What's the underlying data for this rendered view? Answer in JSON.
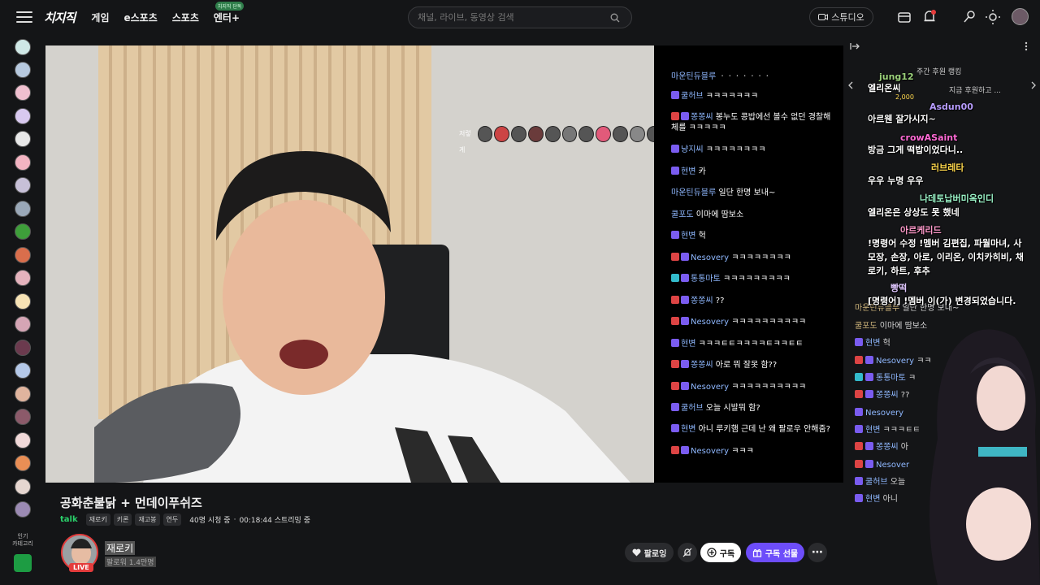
{
  "nav": {
    "logo": "치지직",
    "items": [
      "게임",
      "e스포츠",
      "스포츠",
      "엔터+"
    ],
    "enter_badge": "치지직 단독",
    "search_placeholder": "채널, 라이브, 동영상 검색",
    "studio_label": "스튜디오"
  },
  "sidebar": {
    "popular_label_1": "인기",
    "popular_label_2": "카테고리"
  },
  "video": {
    "emote_prefix": "저렇게"
  },
  "video_chat": [
    {
      "nick": "마운틴듀블루",
      "text": "ㆍㆍㆍㆍㆍㆍㆍ"
    },
    {
      "nick": "쿨허브",
      "text": "ㅋㅋㅋㅋㅋㅋㅋ"
    },
    {
      "nick": "쫑쫑씨",
      "text": "봉누도 콩밥에선 볼수 없던 경찰해체를 ㅋㅋㅋㅋㅋ"
    },
    {
      "nick": "냥지씨",
      "text": "ㅋㅋㅋㅋㅋㅋㅋㅋ"
    },
    {
      "nick": "현변",
      "text": "카"
    },
    {
      "nick": "마운틴듀블루",
      "text": "일단 한명 보내~"
    },
    {
      "nick": "쿨포도",
      "text": "이마에 땀보소"
    },
    {
      "nick": "현변",
      "text": "헉"
    },
    {
      "nick": "Nesovery",
      "text": "ㅋㅋㅋㅋㅋㅋㅋㅋ"
    },
    {
      "nick": "통통마토",
      "text": "ㅋㅋㅋㅋㅋㅋㅋㅋㅋ"
    },
    {
      "nick": "쫑쫑씨",
      "text": "??"
    },
    {
      "nick": "Nesovery",
      "text": "ㅋㅋㅋㅋㅋㅋㅋㅋㅋㅋ"
    },
    {
      "nick": "현변",
      "text": "ㅋㅋㅋㅌㅌㅋㅋㅋㅋㅌㅋㅋㅌㅌ"
    },
    {
      "nick": "쫑쫑씨",
      "text": "아로 뭐 잘못 함??"
    },
    {
      "nick": "Nesovery",
      "text": "ㅋㅋㅋㅋㅋㅋㅋㅋㅋㅋ"
    },
    {
      "nick": "쿨허브",
      "text": "오늘 시발뭐 함?"
    },
    {
      "nick": "현변",
      "text": "아니 루키햄 근데 난 왜 팔로우 안해줌?"
    },
    {
      "nick": "Nesovery",
      "text": "ㅋㅋㅋ"
    }
  ],
  "stream": {
    "title": "공화춘불닭 + 먼데이푸쉬즈",
    "talk_label": "talk",
    "tags": [
      "재로키",
      "키론",
      "재고봉",
      "연두"
    ],
    "viewers": "40명 시청 중",
    "duration": "00:18:44 스트리밍 중",
    "streamer_name": "재로키",
    "followers": "팔로워 1.4만명",
    "live_label": "LIVE",
    "follow_label": "팔로잉",
    "subscribe_label": "구독",
    "gift_label": "구독 선물"
  },
  "right_chat": {
    "ranking_label": "주간 후원 랭킹",
    "donate_now": "지금 후원하고 ...",
    "overlay": [
      {
        "kind": "nick",
        "text": "jung12",
        "color": "#9ad07a"
      },
      {
        "kind": "text",
        "text": "엘리온씨"
      },
      {
        "kind": "amount",
        "text": "2,000"
      },
      {
        "kind": "nick",
        "text": "Asdun00",
        "color": "#b79cff"
      },
      {
        "kind": "text",
        "text": "아르웬 잘가시지~"
      },
      {
        "kind": "nick",
        "text": "crowASaint",
        "color": "#ff6ad5"
      },
      {
        "kind": "text",
        "text": "방금 그게 떡밥이었다니.."
      },
      {
        "kind": "nick",
        "text": "러브레타",
        "color": "#ffd84d"
      },
      {
        "kind": "text",
        "text": "우우 누명 우우"
      },
      {
        "kind": "nick",
        "text": "나데토납버미옥인디",
        "color": "#9bf4c8"
      },
      {
        "kind": "text",
        "text": "엘리온은 상상도 못 했네"
      },
      {
        "kind": "nick",
        "text": "아르케리드",
        "color": "#ff9acb"
      },
      {
        "kind": "text",
        "text": "!명령어 수정 !멤버 김편집, 파월마녀, 사"
      },
      {
        "kind": "text",
        "text": "모장, 손장, 아로, 이리온, 이치카히비, 채"
      },
      {
        "kind": "text",
        "text": "로키, 하트, 후추"
      },
      {
        "kind": "nick",
        "text": "빵떡",
        "color": "#e0c7ff"
      },
      {
        "kind": "text",
        "text": "[명령어] !멤버 이(가) 변경되었습니다."
      }
    ],
    "bg_lines": [
      {
        "nick": "마운틴듀블루",
        "text": "일단 한명 보내~"
      },
      {
        "nick": "쿨포도",
        "text": "이마에 땀보소"
      },
      {
        "nick": "현변",
        "text": "헉"
      },
      {
        "nick": "Nesovery",
        "text": "ㅋㅋ"
      },
      {
        "nick": "통통마토",
        "text": "ㅋ"
      },
      {
        "nick": "쫑쫑씨",
        "text": "??"
      },
      {
        "nick": "Nesovery",
        "text": ""
      },
      {
        "nick": "현변",
        "text": "ㅋㅋㅋㅌㅌ"
      },
      {
        "nick": "쫑쫑씨",
        "text": "아"
      },
      {
        "nick": "Nesover",
        "text": ""
      },
      {
        "nick": "쿨허브",
        "text": "오늘"
      },
      {
        "nick": "현변",
        "text": "아니"
      }
    ]
  },
  "colors": {
    "accent_green": "#2ad06a",
    "live_red": "#e43b3b",
    "gift_purple": "#6d4dfa",
    "chat_nick": "#8fb8ff"
  }
}
